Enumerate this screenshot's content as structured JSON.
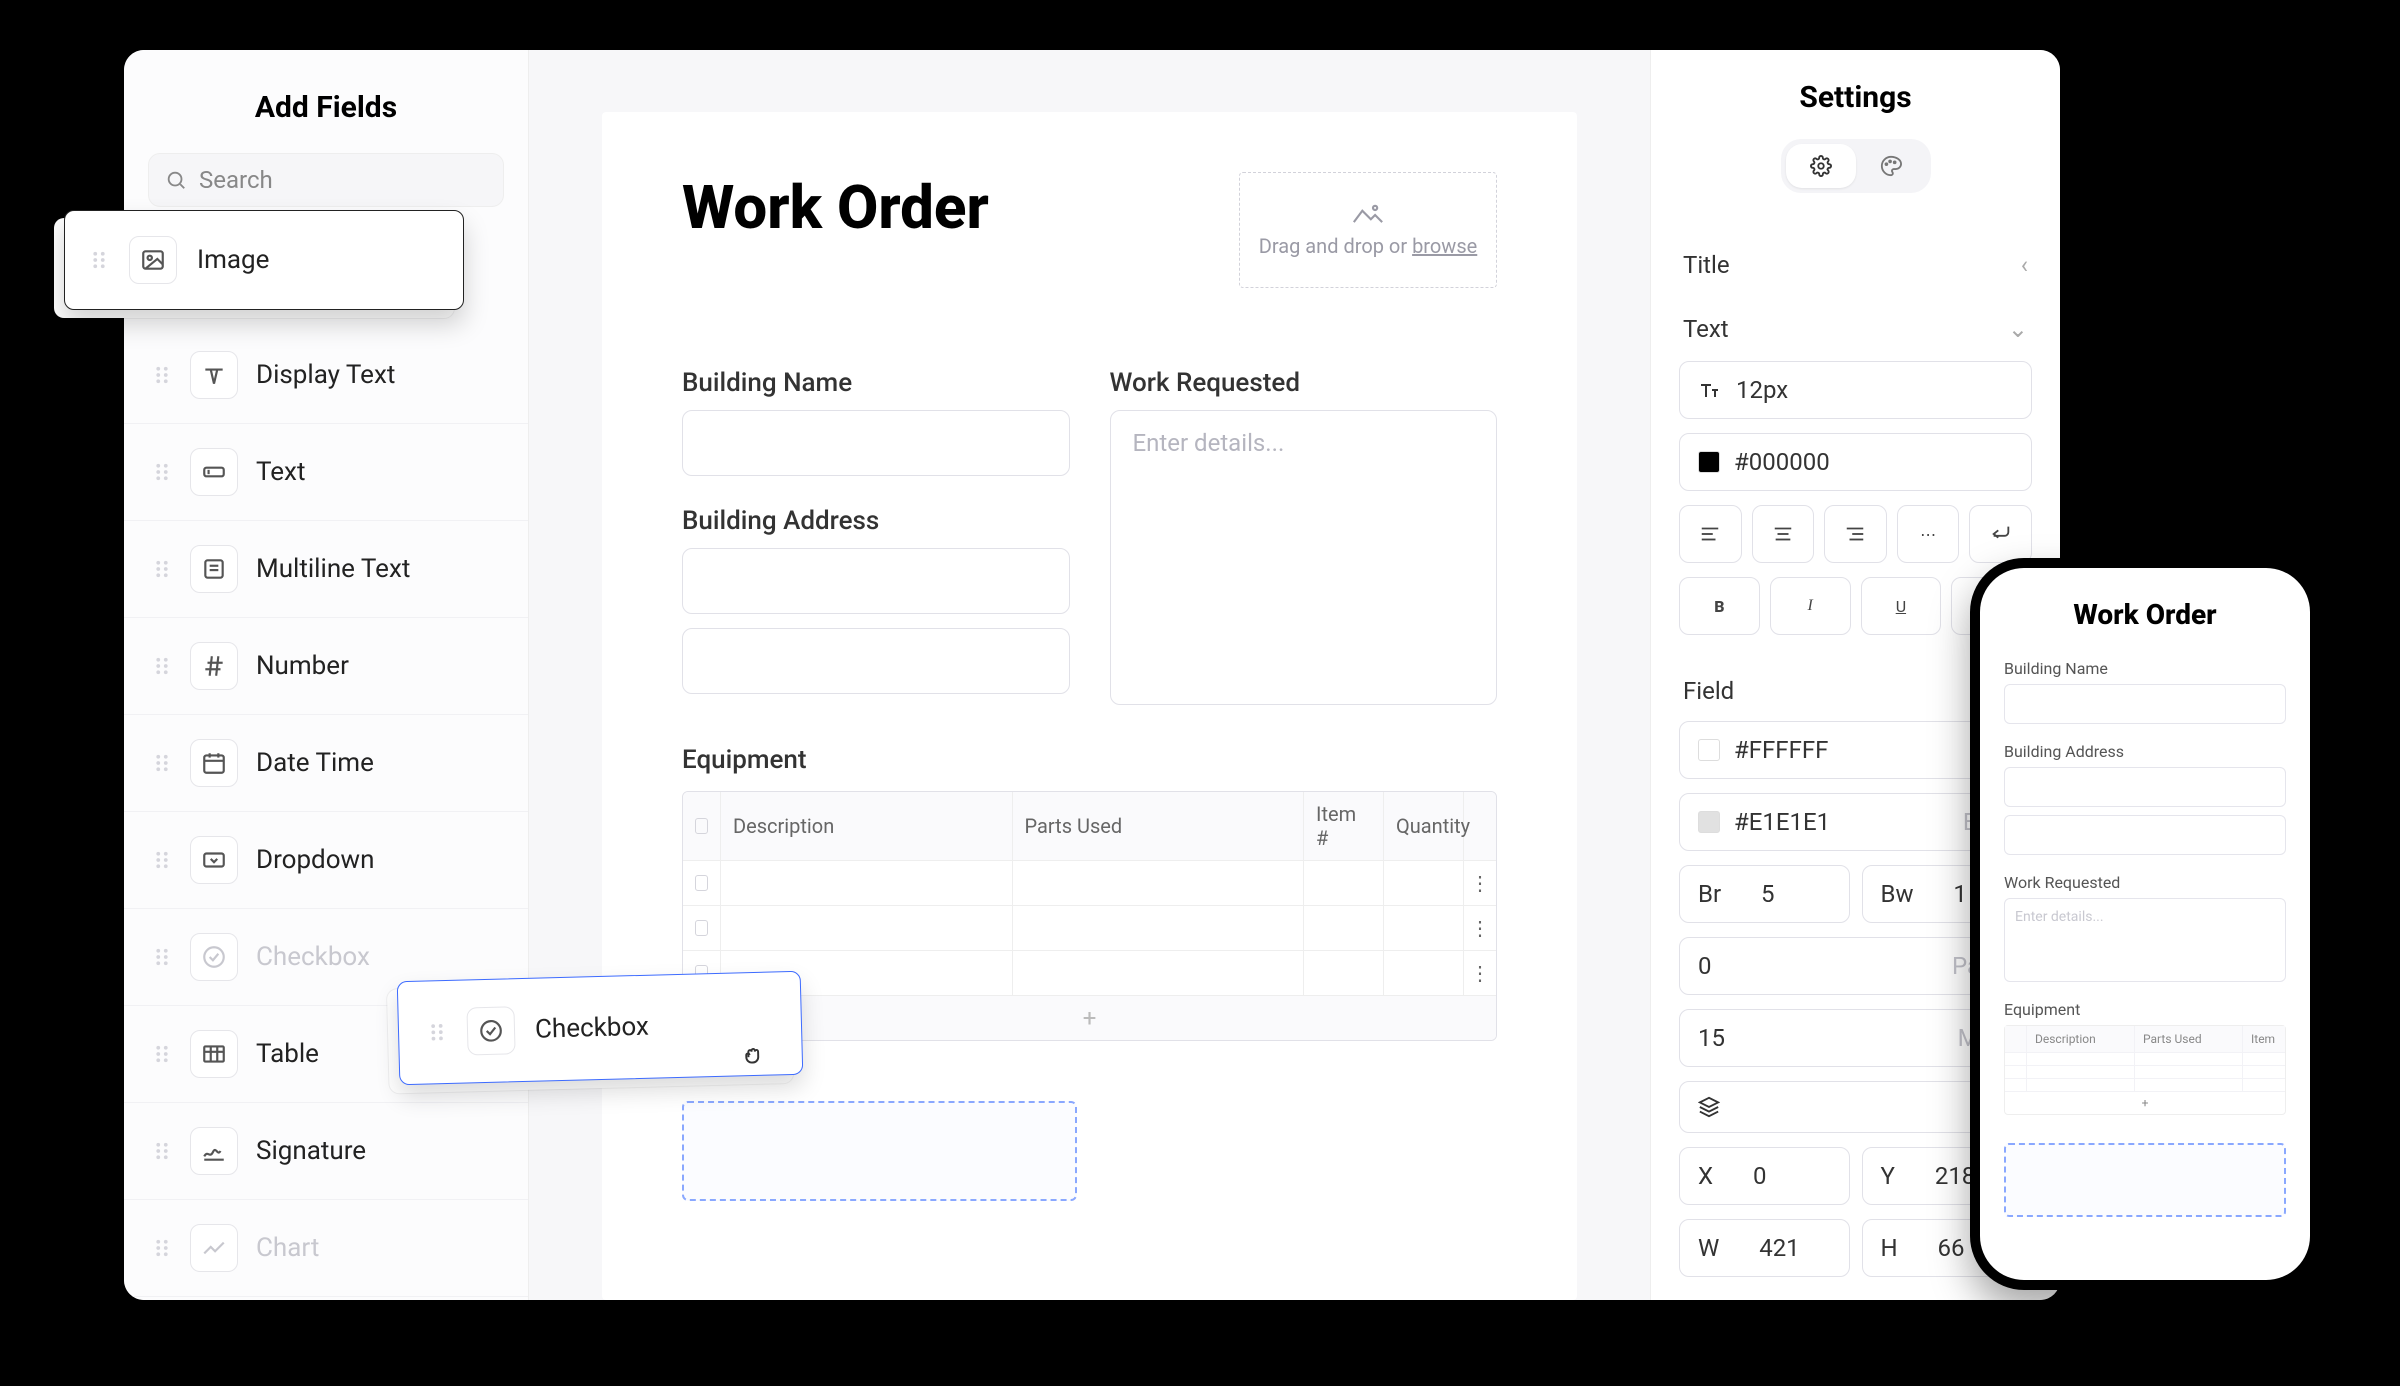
{
  "sidebar": {
    "title": "Add Fields",
    "search_placeholder": "Search",
    "fields": [
      {
        "label": "Image"
      },
      {
        "label": "Display Text"
      },
      {
        "label": "Text"
      },
      {
        "label": "Multiline Text"
      },
      {
        "label": "Number"
      },
      {
        "label": "Date Time"
      },
      {
        "label": "Dropdown"
      },
      {
        "label": "Checkbox"
      },
      {
        "label": "Table"
      },
      {
        "label": "Signature"
      },
      {
        "label": "Chart"
      }
    ]
  },
  "floating": {
    "image_label": "Image",
    "checkbox_label": "Checkbox"
  },
  "canvas": {
    "title": "Work Order",
    "upload_prefix": "Drag and drop or ",
    "upload_browse": "browse",
    "building_name_label": "Building Name",
    "building_address_label": "Building Address",
    "work_requested_label": "Work Requested",
    "work_requested_placeholder": "Enter details...",
    "equipment_label": "Equipment",
    "table_headers": {
      "description": "Description",
      "parts_used": "Parts Used",
      "item_no": "Item #",
      "quantity": "Quantity"
    },
    "add_row": "+"
  },
  "settings": {
    "title": "Settings",
    "sections": {
      "title_label": "Title",
      "text_label": "Text",
      "field_label": "Field"
    },
    "text": {
      "font_size": "12px",
      "color": "#000000"
    },
    "field": {
      "bg_color": "#FFFFFF",
      "border_color": "#E1E1E1",
      "border_color_hint": "Bord",
      "br_label": "Br",
      "br_value": "5",
      "bw_label": "Bw",
      "bw_value": "1",
      "padding_value": "0",
      "padding_hint": "Paddi",
      "margin_value": "15",
      "margin_hint": "Marg",
      "x_label": "X",
      "x_value": "0",
      "y_label": "Y",
      "y_value": "218",
      "w_label": "W",
      "w_value": "421",
      "h_label": "H",
      "h_value": "66"
    }
  },
  "phone": {
    "title": "Work Order",
    "building_name_label": "Building Name",
    "building_address_label": "Building Address",
    "work_requested_label": "Work Requested",
    "work_requested_placeholder": "Enter details...",
    "equipment_label": "Equipment",
    "table_headers": {
      "description": "Description",
      "parts_used": "Parts Used",
      "item": "Item"
    },
    "add_row": "+"
  }
}
